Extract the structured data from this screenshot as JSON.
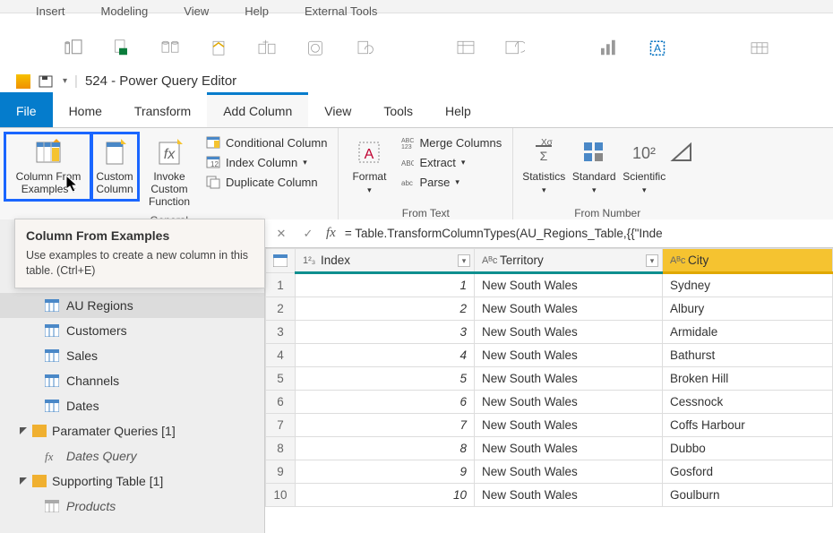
{
  "top_menu": {
    "insert": "Insert",
    "modeling": "Modeling",
    "view": "View",
    "help": "Help",
    "external": "External Tools"
  },
  "title": "524 - Power Query Editor",
  "tabs": {
    "file": "File",
    "home": "Home",
    "transform": "Transform",
    "addcol": "Add Column",
    "view": "View",
    "tools": "Tools",
    "help": "Help"
  },
  "ribbon": {
    "col_from_examples": "Column From Examples",
    "custom_column": "Custom Column",
    "invoke_custom": "Invoke Custom Function",
    "general": "General",
    "conditional": "Conditional Column",
    "index": "Index Column",
    "duplicate": "Duplicate Column",
    "format": "Format",
    "merge": "Merge Columns",
    "extract": "Extract",
    "parse": "Parse",
    "from_text": "From Text",
    "statistics": "Statistics",
    "standard": "Standard",
    "scientific": "Scientific",
    "from_number": "From Number"
  },
  "tooltip": {
    "title": "Column From Examples",
    "desc": "Use examples to create a new column in this table. (Ctrl+E)"
  },
  "sidebar": {
    "au_regions": "AU Regions",
    "customers": "Customers",
    "sales": "Sales",
    "channels": "Channels",
    "dates": "Dates",
    "param_folder": "Paramater Queries [1]",
    "dates_query": "Dates Query",
    "support_folder": "Supporting Table [1]",
    "products": "Products"
  },
  "formula": "= Table.TransformColumnTypes(AU_Regions_Table,{{\"Inde",
  "columns": {
    "index": "Index",
    "territory": "Territory",
    "city": "City"
  },
  "rows": [
    {
      "n": 1,
      "idx": 1,
      "terr": "New South Wales",
      "city": "Sydney"
    },
    {
      "n": 2,
      "idx": 2,
      "terr": "New South Wales",
      "city": "Albury"
    },
    {
      "n": 3,
      "idx": 3,
      "terr": "New South Wales",
      "city": "Armidale"
    },
    {
      "n": 4,
      "idx": 4,
      "terr": "New South Wales",
      "city": "Bathurst"
    },
    {
      "n": 5,
      "idx": 5,
      "terr": "New South Wales",
      "city": "Broken Hill"
    },
    {
      "n": 6,
      "idx": 6,
      "terr": "New South Wales",
      "city": "Cessnock"
    },
    {
      "n": 7,
      "idx": 7,
      "terr": "New South Wales",
      "city": "Coffs Harbour"
    },
    {
      "n": 8,
      "idx": 8,
      "terr": "New South Wales",
      "city": "Dubbo"
    },
    {
      "n": 9,
      "idx": 9,
      "terr": "New South Wales",
      "city": "Gosford"
    },
    {
      "n": 10,
      "idx": 10,
      "terr": "New South Wales",
      "city": "Goulburn"
    }
  ]
}
